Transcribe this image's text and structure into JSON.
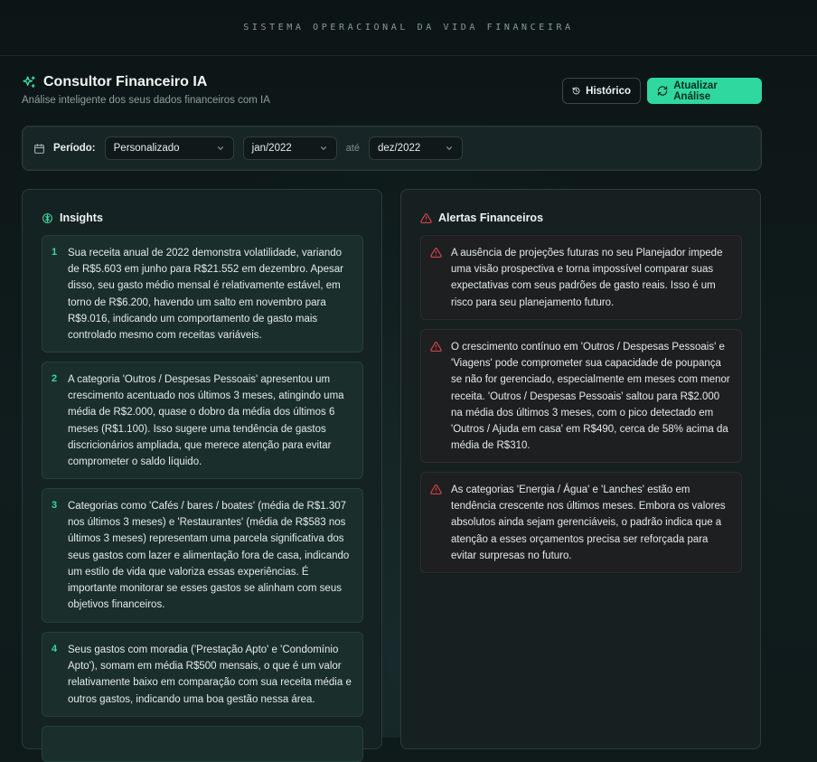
{
  "topbar": {
    "title": "SISTEMA OPERACIONAL DA VIDA FINANCEIRA"
  },
  "header": {
    "title": "Consultor Financeiro IA",
    "subtitle": "Análise inteligente dos seus dados financeiros com IA",
    "history_label": "Histórico",
    "update_label": "Atualizar Análise"
  },
  "period": {
    "label": "Período:",
    "mode": "Personalizado",
    "start": "jan/2022",
    "separator": "até",
    "end": "dez/2022"
  },
  "insights": {
    "title": "Insights",
    "items": [
      {
        "num": "1",
        "text": "Sua receita anual de 2022 demonstra volatilidade, variando de R$5.603 em junho para R$21.552 em dezembro. Apesar disso, seu gasto médio mensal é relativamente estável, em torno de R$6.200, havendo um salto em novembro para R$9.016, indicando um comportamento de gasto mais controlado mesmo com receitas variáveis."
      },
      {
        "num": "2",
        "text": "A categoria 'Outros / Despesas Pessoais' apresentou um crescimento acentuado nos últimos 3 meses, atingindo uma média de R$2.000, quase o dobro da média dos últimos 6 meses (R$1.100). Isso sugere uma tendência de gastos discricionários ampliada, que merece atenção para evitar comprometer o saldo líquido."
      },
      {
        "num": "3",
        "text": "Categorias como 'Cafés / bares / boates' (média de R$1.307 nos últimos 3 meses) e 'Restaurantes' (média de R$583 nos últimos 3 meses) representam uma parcela significativa dos seus gastos com lazer e alimentação fora de casa, indicando um estilo de vida que valoriza essas experiências. É importante monitorar se esses gastos se alinham com seus objetivos financeiros."
      },
      {
        "num": "4",
        "text": "Seus gastos com moradia ('Prestação Apto' e 'Condomínio Apto'), somam em média R$500 mensais, o que é um valor relativamente baixo em comparação com sua receita média e outros gastos, indicando uma boa gestão nessa área."
      }
    ]
  },
  "alerts": {
    "title": "Alertas Financeiros",
    "items": [
      {
        "text": "A ausência de projeções futuras no seu Planejador impede uma visão prospectiva e torna impossível comparar suas expectativas com seus padrões de gasto reais. Isso é um risco para seu planejamento futuro."
      },
      {
        "text": "O crescimento contínuo em 'Outros / Despesas Pessoais' e 'Viagens' pode comprometer sua capacidade de poupança se não for gerenciado, especialmente em meses com menor receita. 'Outros / Despesas Pessoais' saltou para R$2.000 na média dos últimos 3 meses, com o pico detectado em 'Outros / Ajuda em casa' em R$490, cerca de 58% acima da média de R$310."
      },
      {
        "text": "As categorias 'Energia / Água' e 'Lanches' estão em tendência crescente nos últimos meses. Embora os valores absolutos ainda sejam gerenciáveis, o padrão indica que a atenção a esses orçamentos precisa ser reforçada para evitar surpresas no futuro."
      }
    ]
  },
  "colors": {
    "accent": "#2fd89f",
    "alert": "#e5484d",
    "background": "#0f1a1b"
  }
}
